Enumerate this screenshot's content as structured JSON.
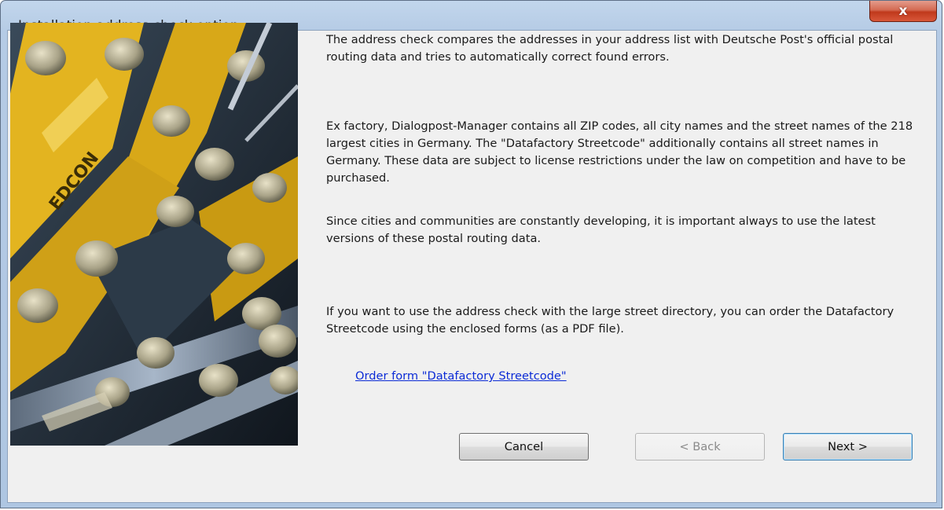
{
  "window": {
    "title": "Installation address check option",
    "close_label": "x"
  },
  "content": {
    "paragraphs": [
      "The address check compares the addresses in your address list with Deutsche Post's official postal routing data and tries to automatically correct found errors.",
      "Ex factory, Dialogpost-Manager contains all ZIP codes, all city names and the street names of the 218 largest cities in Germany. The \"Datafactory Streetcode\" additionally contains all street names in Germany. These data are subject to license restrictions under the law on competition and have to be purchased.",
      "Since cities and communities are constantly developing, it is important always to use the latest versions of these postal routing data.",
      "If you want to use the address check with the large street directory, you can order the Datafactory Streetcode using the enclosed forms (as a PDF file)."
    ],
    "link_text": "Order form \"Datafactory Streetcode\"",
    "image_brand": "EDCON"
  },
  "buttons": {
    "cancel": "Cancel",
    "back": "< Back",
    "next": "Next >"
  },
  "colors": {
    "link": "#0b2bd6",
    "close_button": "#c7402a",
    "title_bar": "#b9cfe8"
  }
}
